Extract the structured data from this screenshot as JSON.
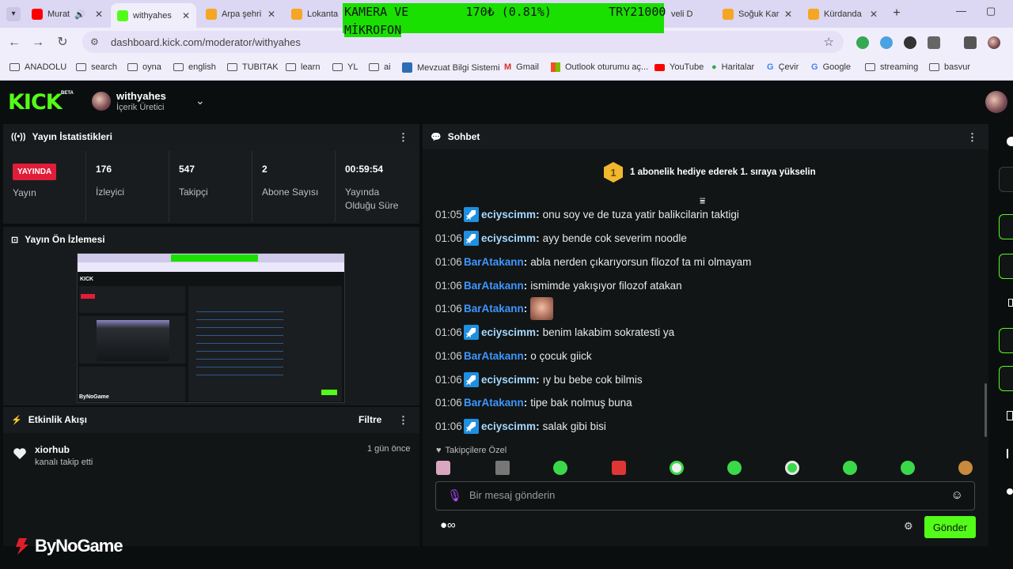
{
  "browser": {
    "tabs": [
      {
        "label": "Murat",
        "favicon_color": "#ff0000",
        "audio_icon": "speaker-icon"
      },
      {
        "label": "withyahes",
        "favicon_color": "#53fc18",
        "active": true
      },
      {
        "label": "Arpa şehri",
        "favicon_color": "#f5a623"
      },
      {
        "label": "Lokanta",
        "favicon_color": "#f5a623"
      },
      {
        "label": "veli D",
        "favicon_color": "#f5a623"
      },
      {
        "label": "Soğuk Kar",
        "favicon_color": "#f5a623"
      },
      {
        "label": "Kürdanda",
        "favicon_color": "#f5a623"
      }
    ],
    "overlay": {
      "line1": "KAMERA VE        170₺ (0.81%)        TRY21000",
      "line2": "MİKROFON"
    },
    "url": "dashboard.kick.com/moderator/withyahes",
    "bookmarks": [
      "ANADOLU",
      "search",
      "oyna",
      "english",
      "TUBITAK",
      "learn",
      "YL",
      "ai",
      "Mevzuat Bilgi Sistemi",
      "Gmail",
      "Outlook oturumu aç...",
      "YouTube",
      "Haritalar",
      "Çevir",
      "Google",
      "streaming",
      "basvur"
    ]
  },
  "kick": {
    "logo": "KICK",
    "beta": "BETA",
    "channel_name": "withyahes",
    "channel_role": "İçerik Üretici"
  },
  "stats": {
    "title": "Yayın İstatistikleri",
    "live_badge": "YAYINDA",
    "live_label": "Yayın",
    "items": [
      {
        "value": "176",
        "label": "İzleyici"
      },
      {
        "value": "547",
        "label": "Takipçi"
      },
      {
        "value": "2",
        "label": "Abone Sayısı"
      },
      {
        "value": "00:59:54",
        "label": "Yayında Olduğu Süre"
      }
    ]
  },
  "preview": {
    "title": "Yayın Ön İzlemesi"
  },
  "activity": {
    "title": "Etkinlik Akışı",
    "filter_label": "Filtre",
    "items": [
      {
        "user": "xiorhub",
        "action": "kanalı takip etti",
        "time": "1 gün önce"
      }
    ]
  },
  "watermark": "ByNoGame",
  "chat": {
    "title": "Sohbet",
    "pinned_rank": "1",
    "pinned_text": "1 abonelik hediye ederek 1. sıraya yükselin",
    "messages": [
      {
        "time": "01:05",
        "user": "eciyscimm",
        "mod": true,
        "text": "onu soy ve de tuza yatir balikcilarin taktigi"
      },
      {
        "time": "01:06",
        "user": "eciyscimm",
        "mod": true,
        "text": "ayy bende cok severim noodle"
      },
      {
        "time": "01:06",
        "user": "BarAtakann",
        "mod": false,
        "text": "abla nerden çıkarıyorsun filozof ta mi olmayam"
      },
      {
        "time": "01:06",
        "user": "BarAtakann",
        "mod": false,
        "text": "ismimde yakışıyor filozof atakan"
      },
      {
        "time": "01:06",
        "user": "BarAtakann",
        "mod": false,
        "text": "",
        "emote": true
      },
      {
        "time": "01:06",
        "user": "eciyscimm",
        "mod": true,
        "text": "benim lakabim sokratesti ya"
      },
      {
        "time": "01:06",
        "user": "BarAtakann",
        "mod": false,
        "text": "o çocuk giick"
      },
      {
        "time": "01:06",
        "user": "eciyscimm",
        "mod": true,
        "text": "ıy bu bebe cok bilmis"
      },
      {
        "time": "01:06",
        "user": "BarAtakann",
        "mod": false,
        "text": "tipe bak nolmuş buna"
      },
      {
        "time": "01:06",
        "user": "eciyscimm",
        "mod": true,
        "text": "salak gibi bisi"
      }
    ],
    "followers_only_label": "Takipçilere Özel",
    "input_placeholder": "Bir mesaj gönderin",
    "send_label": "Gönder",
    "colors": {
      "accent": "#53fc18",
      "mod_badge": "#1f8fe0",
      "user_blue": "#3d97ff",
      "user_cyan": "#a4d8ff",
      "live": "#e01e3a"
    }
  }
}
